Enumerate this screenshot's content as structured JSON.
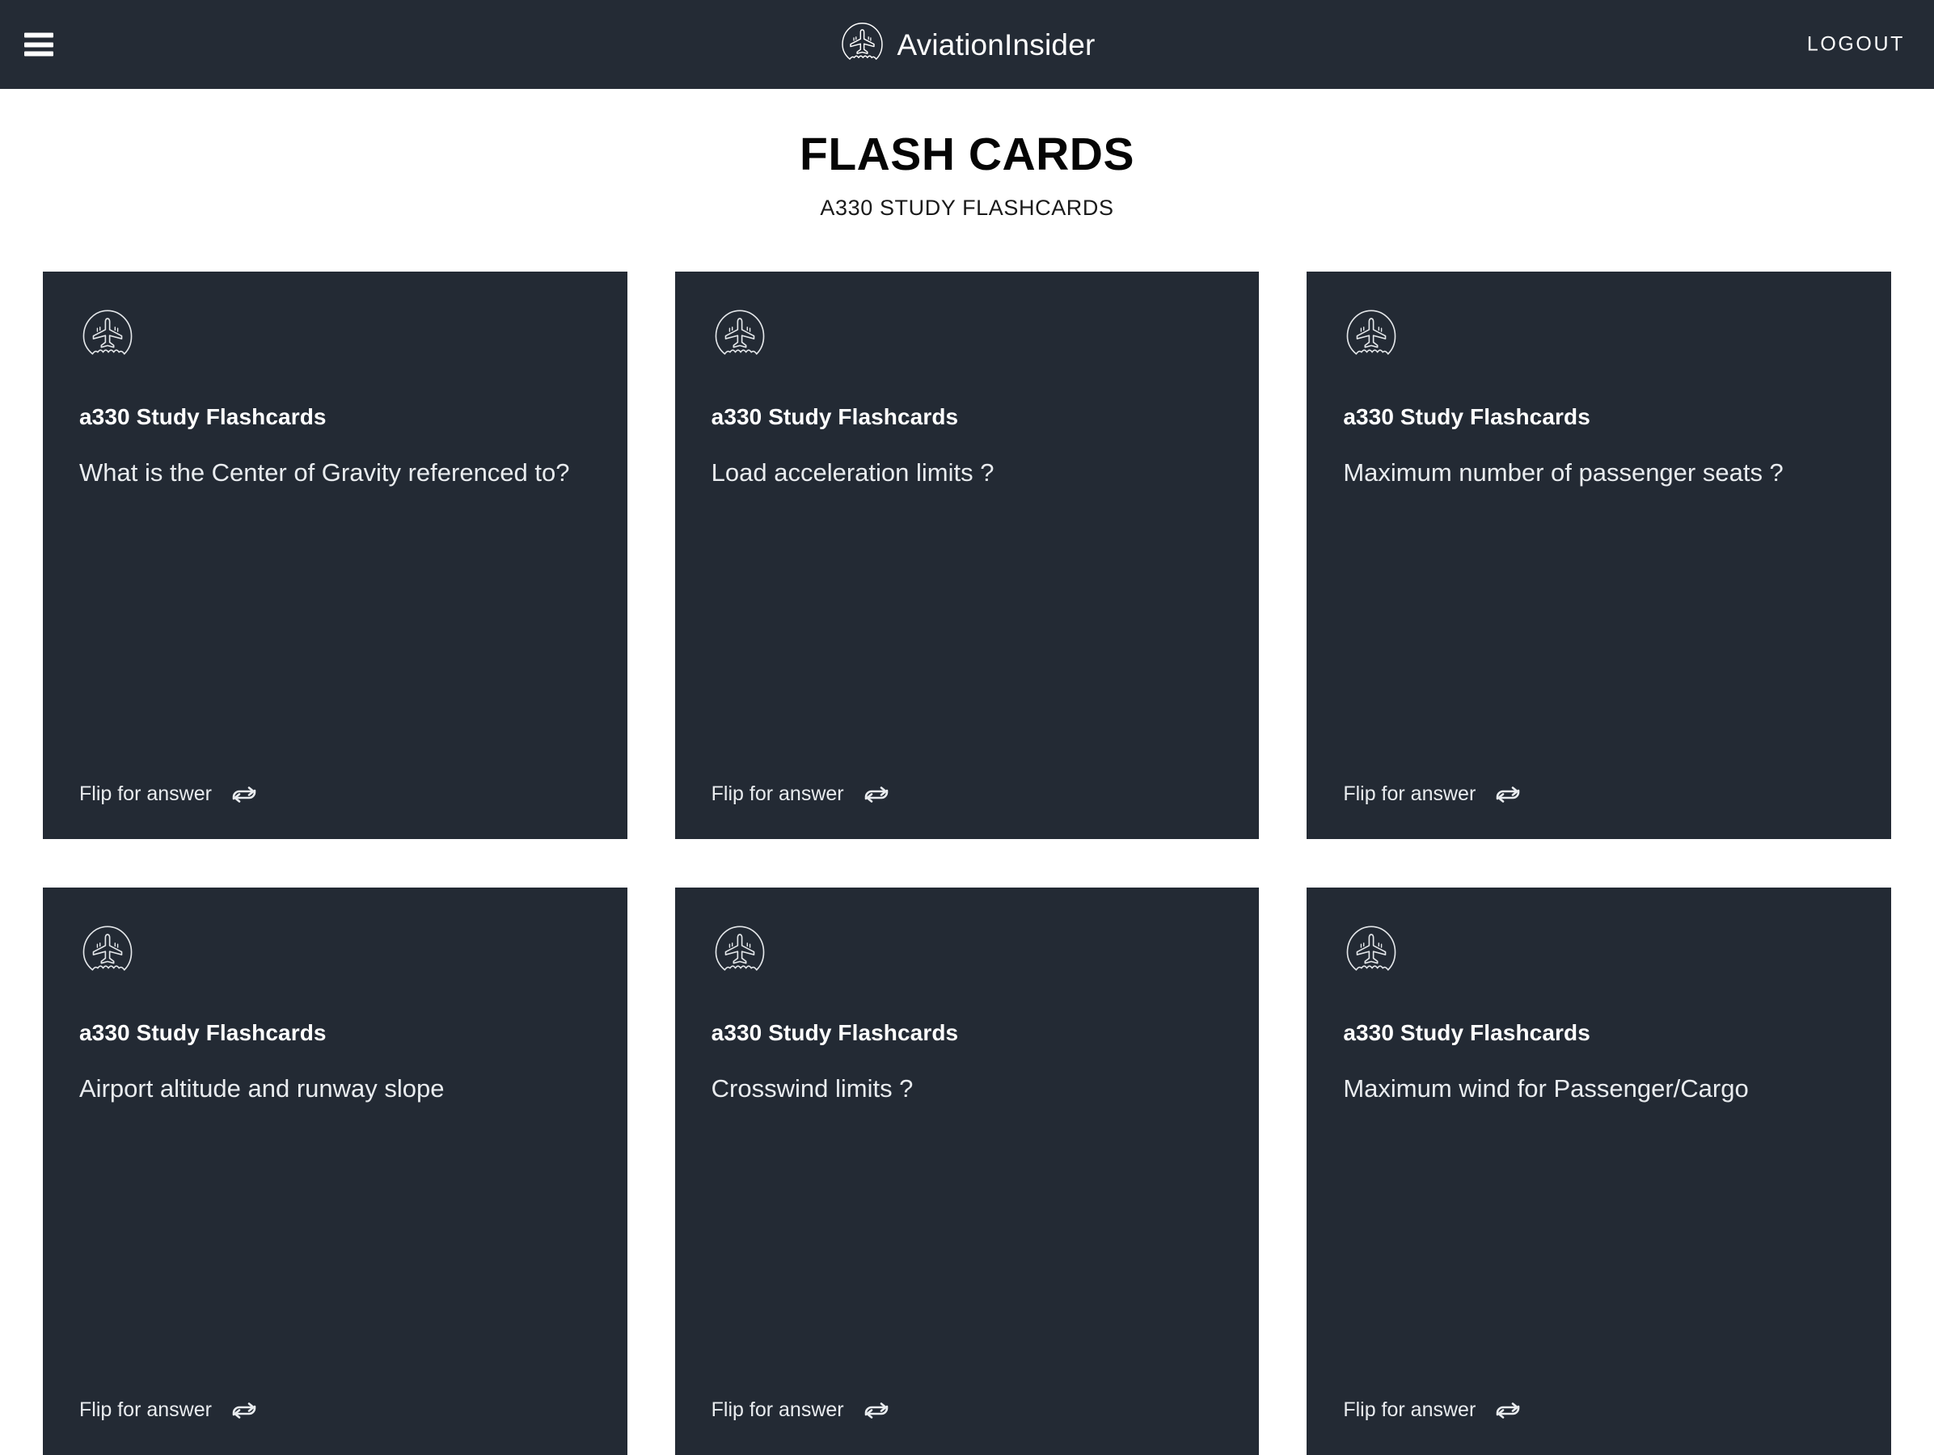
{
  "header": {
    "menu_icon": "hamburger-menu-icon",
    "brand_icon": "airplane-circle-logo-icon",
    "brand_primary": "Aviation",
    "brand_secondary": "Insider",
    "logout_label": "LOGOUT"
  },
  "page": {
    "title": "FLASH CARDS",
    "subtitle": "A330 STUDY FLASHCARDS"
  },
  "cards": [
    {
      "icon": "airplane-circle-icon",
      "kicker": "a330 Study Flashcards",
      "question": "What is the Center of Gravity referenced to?",
      "flip_label": "Flip for answer",
      "flip_icon": "loop-arrows-icon"
    },
    {
      "icon": "airplane-circle-icon",
      "kicker": "a330 Study Flashcards",
      "question": "Load acceleration limits ?",
      "flip_label": "Flip for answer",
      "flip_icon": "loop-arrows-icon"
    },
    {
      "icon": "airplane-circle-icon",
      "kicker": "a330 Study Flashcards",
      "question": "Maximum number of passenger seats ?",
      "flip_label": "Flip for answer",
      "flip_icon": "loop-arrows-icon"
    },
    {
      "icon": "airplane-circle-icon",
      "kicker": "a330 Study Flashcards",
      "question": "Airport altitude and runway slope",
      "flip_label": "Flip for answer",
      "flip_icon": "loop-arrows-icon"
    },
    {
      "icon": "airplane-circle-icon",
      "kicker": "a330 Study Flashcards",
      "question": "Crosswind limits ?",
      "flip_label": "Flip for answer",
      "flip_icon": "loop-arrows-icon"
    },
    {
      "icon": "airplane-circle-icon",
      "kicker": "a330 Study Flashcards",
      "question": "Maximum wind for Passenger/Cargo",
      "flip_label": "Flip for answer",
      "flip_icon": "loop-arrows-icon"
    }
  ],
  "colors": {
    "header_bg": "#242b35",
    "card_bg": "#232a34",
    "page_bg": "#ffffff",
    "text_light": "#ffffff",
    "text_dark": "#050505"
  }
}
